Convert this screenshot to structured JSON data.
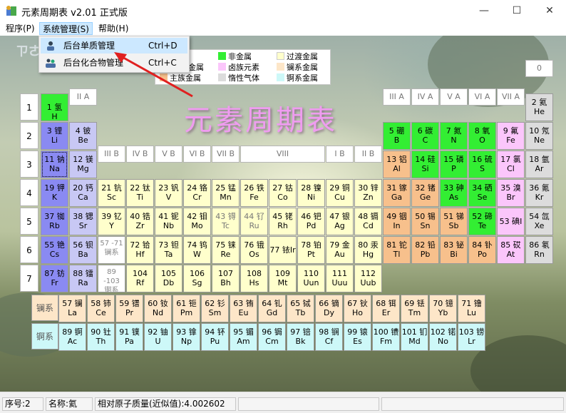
{
  "window": {
    "title": "元素周期表 v2.01 正式版",
    "minimize": "—",
    "maximize": "☐",
    "close": "✕"
  },
  "menu": {
    "items": [
      "程序(P)",
      "系统管理(S)",
      "帮助(H)"
    ]
  },
  "dropdown": [
    {
      "label": "后台单质管理",
      "shortcut": "Ctrl+D"
    },
    {
      "label": "后台化合物管理",
      "shortcut": "Ctrl+C"
    }
  ],
  "watermark": "ㄗㄜ",
  "legend": [
    {
      "label": "非金属",
      "color": "#33ee33"
    },
    {
      "label": "过渡金属",
      "color": "#ffffcc"
    },
    {
      "label": "金属",
      "color": "#8a8af2"
    },
    {
      "label": "卤族元素",
      "color": "#fbc6fb"
    },
    {
      "label": "镧系金属",
      "color": "#fde6c8"
    },
    {
      "label": "主族金属",
      "color": "#f7c08c"
    },
    {
      "label": "惰性气体",
      "color": "#dcdcdc"
    },
    {
      "label": "锕系金属",
      "color": "#cdf8f8"
    }
  ],
  "big_title": "元素周期表",
  "group_labels": [
    "II A",
    "III B",
    "IV B",
    "V B",
    "VI B",
    "VII B",
    "VIII",
    "I B",
    "II B",
    "III A",
    "IV A",
    "V A",
    "VI A",
    "VII A",
    "0"
  ],
  "periods": [
    "1",
    "2",
    "3",
    "4",
    "5",
    "6",
    "7"
  ],
  "lanth_label": "镧系",
  "actin_label": "锕系",
  "status": {
    "seq": "序号:2",
    "name": "名称:氦",
    "mass": "相对原子质量(近似值):4.002602"
  },
  "elements": [
    {
      "t": "1 氢",
      "s": "H",
      "c": "nonmetal",
      "p": 1,
      "g": 1
    },
    {
      "t": "2 氦",
      "s": "He",
      "c": "noble",
      "p": 1,
      "g": 18
    },
    {
      "t": "3 锂",
      "s": "Li",
      "c": "alkali",
      "p": 2,
      "g": 1
    },
    {
      "t": "4 铍",
      "s": "Be",
      "c": "alkaline",
      "p": 2,
      "g": 2
    },
    {
      "t": "5 硼",
      "s": "B",
      "c": "nonmetal",
      "p": 2,
      "g": 13
    },
    {
      "t": "6 碳",
      "s": "C",
      "c": "nonmetal",
      "p": 2,
      "g": 14
    },
    {
      "t": "7 氮",
      "s": "N",
      "c": "nonmetal",
      "p": 2,
      "g": 15
    },
    {
      "t": "8 氧",
      "s": "O",
      "c": "nonmetal",
      "p": 2,
      "g": 16
    },
    {
      "t": "9 氟",
      "s": "Fe",
      "c": "halogen",
      "p": 2,
      "g": 17
    },
    {
      "t": "10 氖",
      "s": "Ne",
      "c": "noble",
      "p": 2,
      "g": 18
    },
    {
      "t": "11 钠",
      "s": "Na",
      "c": "alkali",
      "p": 3,
      "g": 1
    },
    {
      "t": "12 镁",
      "s": "Mg",
      "c": "alkaline",
      "p": 3,
      "g": 2
    },
    {
      "t": "13 铝",
      "s": "Al",
      "c": "metalloid",
      "p": 3,
      "g": 13
    },
    {
      "t": "14 硅",
      "s": "Si",
      "c": "nonmetal",
      "p": 3,
      "g": 14
    },
    {
      "t": "15 磷",
      "s": "P",
      "c": "nonmetal",
      "p": 3,
      "g": 15
    },
    {
      "t": "16 硫",
      "s": "S",
      "c": "nonmetal",
      "p": 3,
      "g": 16
    },
    {
      "t": "17 氯",
      "s": "Cl",
      "c": "halogen",
      "p": 3,
      "g": 17
    },
    {
      "t": "18 氩",
      "s": "Ar",
      "c": "noble",
      "p": 3,
      "g": 18
    },
    {
      "t": "19 钾",
      "s": "K",
      "c": "alkali",
      "p": 4,
      "g": 1
    },
    {
      "t": "20 钙",
      "s": "Ca",
      "c": "alkaline",
      "p": 4,
      "g": 2
    },
    {
      "t": "21 钪",
      "s": "Sc",
      "c": "trans",
      "p": 4,
      "g": 3
    },
    {
      "t": "22 钛",
      "s": "Ti",
      "c": "trans",
      "p": 4,
      "g": 4
    },
    {
      "t": "23 钒",
      "s": "V",
      "c": "trans",
      "p": 4,
      "g": 5
    },
    {
      "t": "24 铬",
      "s": "Cr",
      "c": "trans",
      "p": 4,
      "g": 6
    },
    {
      "t": "25 锰",
      "s": "Mn",
      "c": "trans",
      "p": 4,
      "g": 7
    },
    {
      "t": "26 铁",
      "s": "Fe",
      "c": "trans",
      "p": 4,
      "g": 8
    },
    {
      "t": "27 钴",
      "s": "Co",
      "c": "trans",
      "p": 4,
      "g": 9
    },
    {
      "t": "28 镍",
      "s": "Ni",
      "c": "trans",
      "p": 4,
      "g": 10
    },
    {
      "t": "29 铜",
      "s": "Cu",
      "c": "trans",
      "p": 4,
      "g": 11
    },
    {
      "t": "30 锌",
      "s": "Zn",
      "c": "trans",
      "p": 4,
      "g": 12
    },
    {
      "t": "31 镓",
      "s": "Ga",
      "c": "metalloid",
      "p": 4,
      "g": 13
    },
    {
      "t": "32 锗",
      "s": "Ge",
      "c": "metalloid",
      "p": 4,
      "g": 14
    },
    {
      "t": "33 砷",
      "s": "As",
      "c": "nonmetal",
      "p": 4,
      "g": 15
    },
    {
      "t": "34 硒",
      "s": "Se",
      "c": "nonmetal",
      "p": 4,
      "g": 16
    },
    {
      "t": "35 溴",
      "s": "Br",
      "c": "halogen",
      "p": 4,
      "g": 17
    },
    {
      "t": "36 氪",
      "s": "Kr",
      "c": "noble",
      "p": 4,
      "g": 18
    },
    {
      "t": "37 铷",
      "s": "Rb",
      "c": "alkali",
      "p": 5,
      "g": 1
    },
    {
      "t": "38 锶",
      "s": "Sr",
      "c": "alkaline",
      "p": 5,
      "g": 2
    },
    {
      "t": "39 钇",
      "s": "Y",
      "c": "trans",
      "p": 5,
      "g": 3
    },
    {
      "t": "40 锆",
      "s": "Zr",
      "c": "trans",
      "p": 5,
      "g": 4
    },
    {
      "t": "41 铌",
      "s": "Nb",
      "c": "trans",
      "p": 5,
      "g": 5
    },
    {
      "t": "42 钼",
      "s": "Mo",
      "c": "trans",
      "p": 5,
      "g": 6
    },
    {
      "t": "43 锝",
      "s": "Tc",
      "c": "trans",
      "p": 5,
      "g": 7
    },
    {
      "t": "44 钌",
      "s": "Ru",
      "c": "trans",
      "p": 5,
      "g": 8
    },
    {
      "t": "45 铑",
      "s": "Rh",
      "c": "trans",
      "p": 5,
      "g": 9
    },
    {
      "t": "46 钯",
      "s": "Pd",
      "c": "trans",
      "p": 5,
      "g": 10
    },
    {
      "t": "47 银",
      "s": "Ag",
      "c": "trans",
      "p": 5,
      "g": 11
    },
    {
      "t": "48 镉",
      "s": "Cd",
      "c": "trans",
      "p": 5,
      "g": 12
    },
    {
      "t": "49 铟",
      "s": "In",
      "c": "metalloid",
      "p": 5,
      "g": 13
    },
    {
      "t": "50 锡",
      "s": "Sn",
      "c": "metalloid",
      "p": 5,
      "g": 14
    },
    {
      "t": "51 锑",
      "s": "Sb",
      "c": "metalloid",
      "p": 5,
      "g": 15
    },
    {
      "t": "52 碲",
      "s": "Te",
      "c": "nonmetal",
      "p": 5,
      "g": 16
    },
    {
      "t": "53 碘I",
      "s": "",
      "c": "halogen",
      "p": 5,
      "g": 17
    },
    {
      "t": "54 氙",
      "s": "Xe",
      "c": "noble",
      "p": 5,
      "g": 18
    },
    {
      "t": "55 铯",
      "s": "Cs",
      "c": "alkali",
      "p": 6,
      "g": 1
    },
    {
      "t": "56 钡",
      "s": "Ba",
      "c": "alkaline",
      "p": 6,
      "g": 2
    },
    {
      "t": "57 -71",
      "s": "镧系",
      "c": "white",
      "p": 6,
      "g": 3
    },
    {
      "t": "72 铪",
      "s": "Hf",
      "c": "trans",
      "p": 6,
      "g": 4
    },
    {
      "t": "73 钽",
      "s": "Ta",
      "c": "trans",
      "p": 6,
      "g": 5
    },
    {
      "t": "74 钨",
      "s": "W",
      "c": "trans",
      "p": 6,
      "g": 6
    },
    {
      "t": "75 铼",
      "s": "Re",
      "c": "trans",
      "p": 6,
      "g": 7
    },
    {
      "t": "76 锇",
      "s": "Os",
      "c": "trans",
      "p": 6,
      "g": 8
    },
    {
      "t": "77 铱Ir",
      "s": "",
      "c": "trans",
      "p": 6,
      "g": 9
    },
    {
      "t": "78 铂",
      "s": "Pt",
      "c": "trans",
      "p": 6,
      "g": 10
    },
    {
      "t": "79 金",
      "s": "Au",
      "c": "trans",
      "p": 6,
      "g": 11
    },
    {
      "t": "80 汞",
      "s": "Hg",
      "c": "trans",
      "p": 6,
      "g": 12
    },
    {
      "t": "81 铊",
      "s": "Tl",
      "c": "metalloid",
      "p": 6,
      "g": 13
    },
    {
      "t": "82 铅",
      "s": "Pb",
      "c": "metalloid",
      "p": 6,
      "g": 14
    },
    {
      "t": "83 铋",
      "s": "Bi",
      "c": "metalloid",
      "p": 6,
      "g": 15
    },
    {
      "t": "84 钋",
      "s": "Po",
      "c": "metalloid",
      "p": 6,
      "g": 16
    },
    {
      "t": "85 砹",
      "s": "At",
      "c": "halogen",
      "p": 6,
      "g": 17
    },
    {
      "t": "86 氡",
      "s": "Rn",
      "c": "noble",
      "p": 6,
      "g": 18
    },
    {
      "t": "87 钫",
      "s": "Fr",
      "c": "alkali",
      "p": 7,
      "g": 1
    },
    {
      "t": "88 镭",
      "s": "Ra",
      "c": "alkaline",
      "p": 7,
      "g": 2
    },
    {
      "t": "89 -103",
      "s": "锕系",
      "c": "white",
      "p": 7,
      "g": 3
    },
    {
      "t": "104",
      "s": "Rf",
      "c": "trans",
      "p": 7,
      "g": 4
    },
    {
      "t": "105",
      "s": "Db",
      "c": "trans",
      "p": 7,
      "g": 5
    },
    {
      "t": "106",
      "s": "Sg",
      "c": "trans",
      "p": 7,
      "g": 6
    },
    {
      "t": "107",
      "s": "Bh",
      "c": "trans",
      "p": 7,
      "g": 7
    },
    {
      "t": "108",
      "s": "Hs",
      "c": "trans",
      "p": 7,
      "g": 8
    },
    {
      "t": "109",
      "s": "Mt",
      "c": "trans",
      "p": 7,
      "g": 9
    },
    {
      "t": "110",
      "s": "Uun",
      "c": "trans",
      "p": 7,
      "g": 10
    },
    {
      "t": "111",
      "s": "Uuu",
      "c": "trans",
      "p": 7,
      "g": 11
    },
    {
      "t": "112",
      "s": "Uub",
      "c": "trans",
      "p": 7,
      "g": 12
    }
  ],
  "lanthanides": [
    {
      "t": "57 镧",
      "s": "La"
    },
    {
      "t": "58 铈",
      "s": "Ce"
    },
    {
      "t": "59 镨",
      "s": "Pr"
    },
    {
      "t": "60 钕",
      "s": "Nd"
    },
    {
      "t": "61 钷",
      "s": "Pm"
    },
    {
      "t": "62 钐",
      "s": "Sm"
    },
    {
      "t": "63 铕",
      "s": "Eu"
    },
    {
      "t": "64 钆",
      "s": "Gd"
    },
    {
      "t": "65 铽",
      "s": "Tb"
    },
    {
      "t": "66 镝",
      "s": "Dy"
    },
    {
      "t": "67 钬",
      "s": "Ho"
    },
    {
      "t": "68 铒",
      "s": "Er"
    },
    {
      "t": "69 铥",
      "s": "Tm"
    },
    {
      "t": "70 镱",
      "s": "Yb"
    },
    {
      "t": "71 镥",
      "s": "Lu"
    }
  ],
  "actinides": [
    {
      "t": "89 锕",
      "s": "Ac"
    },
    {
      "t": "90 钍",
      "s": "Th"
    },
    {
      "t": "91 镤",
      "s": "Pa"
    },
    {
      "t": "92 铀",
      "s": "U"
    },
    {
      "t": "93 镎",
      "s": "Np"
    },
    {
      "t": "94 钚",
      "s": "Pu"
    },
    {
      "t": "95 镅",
      "s": "Am"
    },
    {
      "t": "96 锔",
      "s": "Cm"
    },
    {
      "t": "97 锫",
      "s": "Bk"
    },
    {
      "t": "98 锎",
      "s": "Cf"
    },
    {
      "t": "99 锿",
      "s": "Es"
    },
    {
      "t": "100 镄",
      "s": "Fm"
    },
    {
      "t": "101 钔",
      "s": "Md"
    },
    {
      "t": "102 锘",
      "s": "No"
    },
    {
      "t": "103 铹",
      "s": "Lr"
    }
  ]
}
